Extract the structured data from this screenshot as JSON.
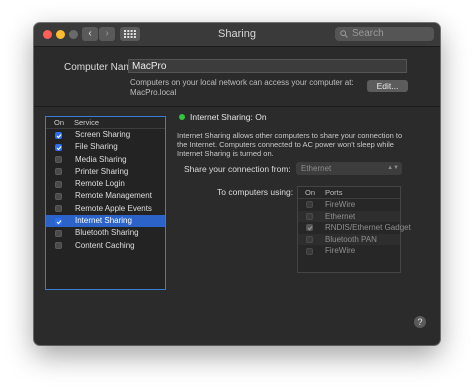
{
  "window": {
    "title": "Sharing",
    "search_placeholder": "Search"
  },
  "computer_name": {
    "label": "Computer Name:",
    "value": "MacPro",
    "description": "Computers on your local network can access your computer at: MacPro.local",
    "edit_label": "Edit..."
  },
  "services": {
    "header_on": "On",
    "header_service": "Service",
    "items": [
      {
        "label": "Screen Sharing",
        "checked": true,
        "selected": false
      },
      {
        "label": "File Sharing",
        "checked": true,
        "selected": false
      },
      {
        "label": "Media Sharing",
        "checked": false,
        "selected": false
      },
      {
        "label": "Printer Sharing",
        "checked": false,
        "selected": false
      },
      {
        "label": "Remote Login",
        "checked": false,
        "selected": false
      },
      {
        "label": "Remote Management",
        "checked": false,
        "selected": false
      },
      {
        "label": "Remote Apple Events",
        "checked": false,
        "selected": false
      },
      {
        "label": "Internet Sharing",
        "checked": true,
        "selected": true
      },
      {
        "label": "Bluetooth Sharing",
        "checked": false,
        "selected": false
      },
      {
        "label": "Content Caching",
        "checked": false,
        "selected": false
      }
    ]
  },
  "detail": {
    "status": "Internet Sharing: On",
    "status_color": "#31c43d",
    "description": "Internet Sharing allows other computers to share your connection to the Internet. Computers connected to AC power won't sleep while Internet Sharing is turned on.",
    "share_from_label": "Share your connection from:",
    "share_from_value": "Ethernet",
    "to_label": "To computers using:",
    "ports_header_on": "On",
    "ports_header_ports": "Ports",
    "ports": [
      {
        "label": "FireWire",
        "checked": false
      },
      {
        "label": "Ethernet",
        "checked": false
      },
      {
        "label": "RNDIS/Ethernet Gadget",
        "checked": true
      },
      {
        "label": "Bluetooth PAN",
        "checked": false
      },
      {
        "label": "FireWire",
        "checked": false
      }
    ]
  },
  "colors": {
    "accent": "#2c63c9",
    "window_bg": "#2b2b2b"
  },
  "icons": {
    "back": "chevron-left-icon",
    "forward": "chevron-right-icon",
    "grid": "grid-icon",
    "search": "search-icon",
    "help": "help-icon"
  }
}
